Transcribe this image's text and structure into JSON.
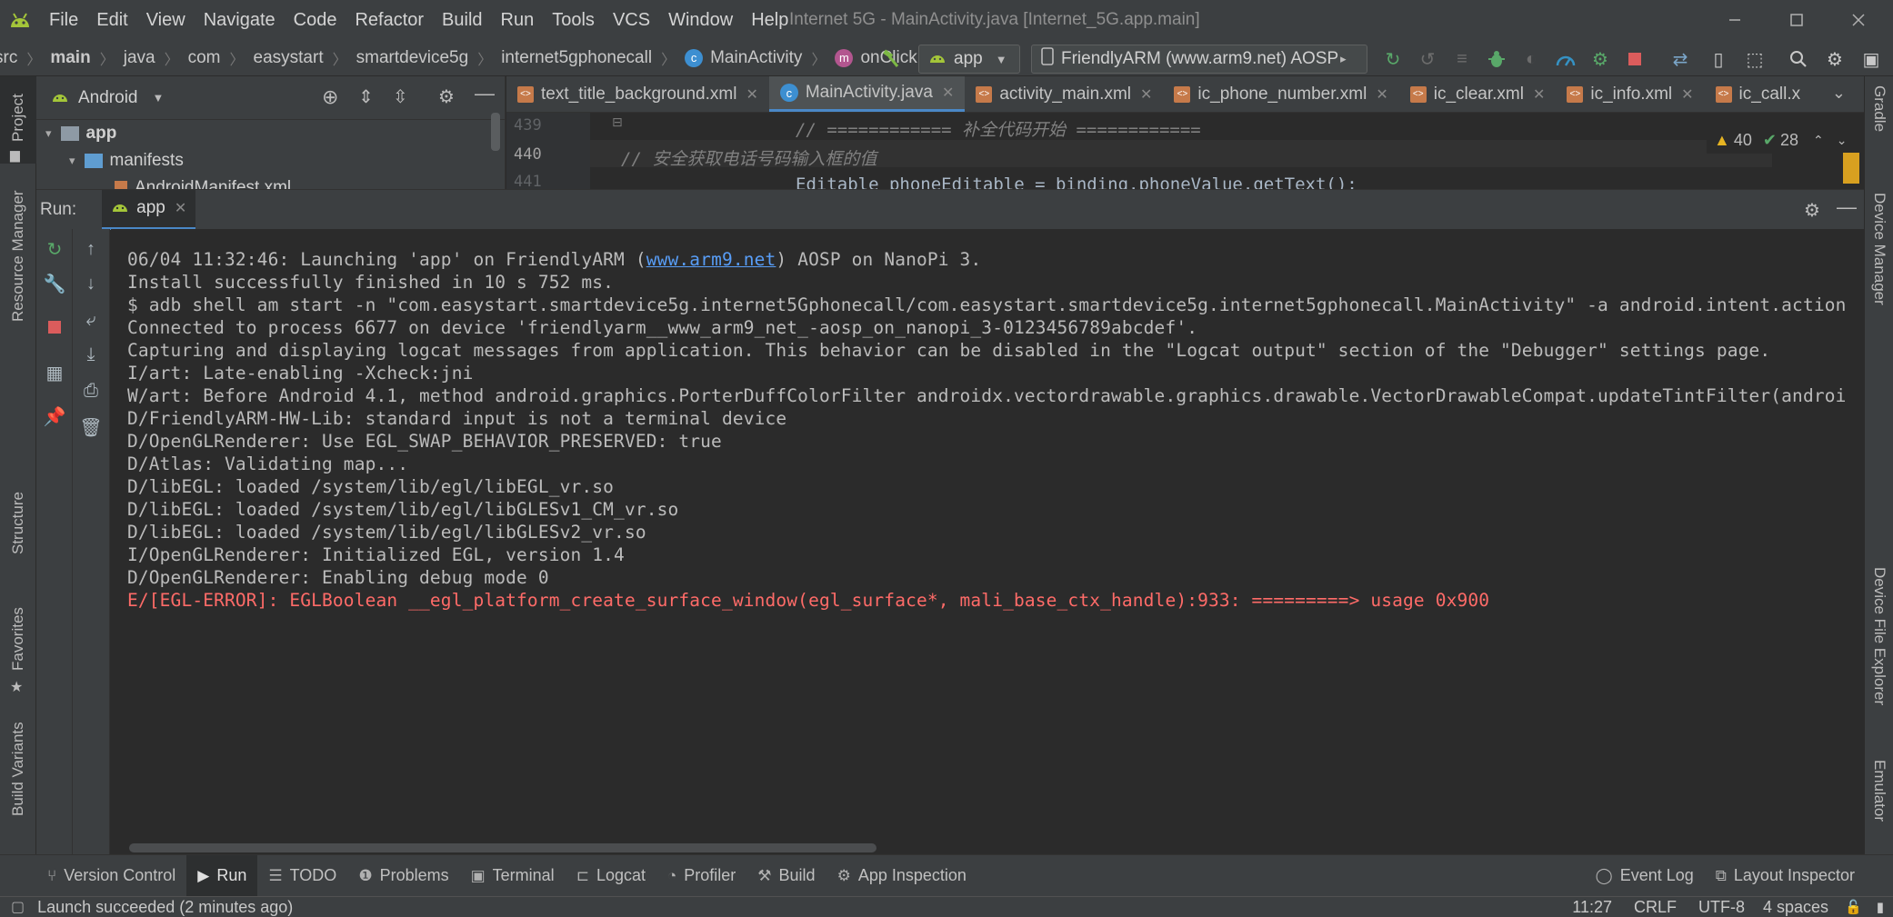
{
  "window": {
    "title": "Internet 5G - MainActivity.java [Internet_5G.app.main]"
  },
  "menu": [
    "File",
    "Edit",
    "View",
    "Navigate",
    "Code",
    "Refactor",
    "Build",
    "Run",
    "Tools",
    "VCS",
    "Window",
    "Help"
  ],
  "breadcrumbs": [
    "src",
    "main",
    "java",
    "com",
    "easystart",
    "smartdevice5g",
    "internet5gphonecall",
    "MainActivity",
    "onClick"
  ],
  "toolbar": {
    "run_config": "app",
    "device": "FriendlyARM (www.arm9.net) AOSP"
  },
  "project_panel": {
    "view_mode": "Android",
    "tree": [
      "app",
      "manifests",
      "AndroidManifest.xml"
    ]
  },
  "editor": {
    "tabs": [
      {
        "label": "text_title_background.xml",
        "type": "xml"
      },
      {
        "label": "MainActivity.java",
        "type": "java",
        "active": true
      },
      {
        "label": "activity_main.xml",
        "type": "xml"
      },
      {
        "label": "ic_phone_number.xml",
        "type": "xml"
      },
      {
        "label": "ic_clear.xml",
        "type": "xml"
      },
      {
        "label": "ic_info.xml",
        "type": "xml"
      },
      {
        "label": "ic_call.x",
        "type": "xml"
      }
    ],
    "warnings": "40",
    "typos": "28",
    "lines": [
      {
        "number": "439",
        "text": "// ============ 补全代码开始 ============"
      },
      {
        "number": "440",
        "text": "// 安全获取电话号码输入框的值"
      },
      {
        "number": "441",
        "text": "Editable phoneEditable = binding.phoneValue.getText();"
      }
    ]
  },
  "run_panel": {
    "label": "Run:",
    "tab": "app",
    "console": [
      {
        "text": "06/04 11:32:46: Launching 'app' on FriendlyARM (",
        "link": "www.arm9.net",
        "after": ") AOSP on NanoPi 3.",
        "type": "info"
      },
      {
        "text": "Install successfully finished in 10 s 752 ms.",
        "type": "info"
      },
      {
        "text": "$ adb shell am start -n \"com.easystart.smartdevice5g.internet5Gphonecall/com.easystart.smartdevice5g.internet5gphonecall.MainActivity\" -a android.intent.action",
        "type": "info"
      },
      {
        "text": "Connected to process 6677 on device 'friendlyarm__www_arm9_net_-aosp_on_nanopi_3-0123456789abcdef'.",
        "type": "info"
      },
      {
        "text": "Capturing and displaying logcat messages from application. This behavior can be disabled in the \"Logcat output\" section of the \"Debugger\" settings page.",
        "type": "info"
      },
      {
        "text": "I/art: Late-enabling -Xcheck:jni",
        "type": "info"
      },
      {
        "text": "W/art: Before Android 4.1, method android.graphics.PorterDuffColorFilter androidx.vectordrawable.graphics.drawable.VectorDrawableCompat.updateTintFilter(androi",
        "type": "info"
      },
      {
        "text": "D/FriendlyARM-HW-Lib: standard input is not a terminal device",
        "type": "info"
      },
      {
        "text": "D/OpenGLRenderer: Use EGL_SWAP_BEHAVIOR_PRESERVED: true",
        "type": "info"
      },
      {
        "text": "D/Atlas: Validating map...",
        "type": "info"
      },
      {
        "text": "D/libEGL: loaded /system/lib/egl/libEGL_vr.so",
        "type": "info"
      },
      {
        "text": "D/libEGL: loaded /system/lib/egl/libGLESv1_CM_vr.so",
        "type": "info"
      },
      {
        "text": "D/libEGL: loaded /system/lib/egl/libGLESv2_vr.so",
        "type": "info"
      },
      {
        "text": "I/OpenGLRenderer: Initialized EGL, version 1.4",
        "type": "info"
      },
      {
        "text": "D/OpenGLRenderer: Enabling debug mode 0",
        "type": "info"
      },
      {
        "text": "E/[EGL-ERROR]: EGLBoolean __egl_platform_create_surface_window(egl_surface*, mali_base_ctx_handle):933: =========> usage 0x900",
        "type": "error"
      }
    ]
  },
  "left_stripe": [
    "Project",
    "Resource Manager",
    "Structure",
    "Favorites",
    "Build Variants"
  ],
  "right_stripe": [
    "Gradle",
    "Device Manager",
    "Device File Explorer",
    "Emulator"
  ],
  "bottom_tabs": [
    {
      "label": "Version Control",
      "icon": "branch-icon"
    },
    {
      "label": "Run",
      "icon": "play-icon",
      "active": true
    },
    {
      "label": "TODO",
      "icon": "list-icon"
    },
    {
      "label": "Problems",
      "icon": "info-icon"
    },
    {
      "label": "Terminal",
      "icon": "terminal-icon"
    },
    {
      "label": "Logcat",
      "icon": "logcat-icon"
    },
    {
      "label": "Profiler",
      "icon": "profiler-icon"
    },
    {
      "label": "Build",
      "icon": "hammer-icon"
    },
    {
      "label": "App Inspection",
      "icon": "inspect-icon"
    }
  ],
  "bottom_right_tabs": [
    {
      "label": "Event Log",
      "icon": "event-log-icon"
    },
    {
      "label": "Layout Inspector",
      "icon": "layout-inspector-icon"
    }
  ],
  "status": {
    "message": "Launch succeeded (2 minutes ago)",
    "position": "11:27",
    "line_separator": "CRLF",
    "encoding": "UTF-8",
    "indent": "4 spaces"
  },
  "colors": {
    "accent": "#4a88c7",
    "android_green": "#a4c639",
    "error": "#ff6b68",
    "link": "#589df6"
  }
}
